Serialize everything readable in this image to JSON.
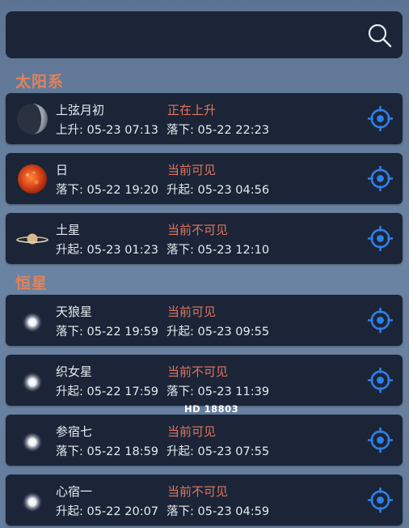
{
  "sections": {
    "solar": "太阳系",
    "stars": "恒星"
  },
  "items": [
    {
      "name": "上弦月初",
      "status": "正在上升",
      "t1_label": "上升:",
      "t1": "05-23 07:13",
      "t2_label": "落下:",
      "t2": "05-22 22:23"
    },
    {
      "name": "日",
      "status": "当前可见",
      "t1_label": "落下:",
      "t1": "05-22 19:20",
      "t2_label": "升起:",
      "t2": "05-23 04:56"
    },
    {
      "name": "土星",
      "status": "当前不可见",
      "t1_label": "升起:",
      "t1": "05-23 01:23",
      "t2_label": "落下:",
      "t2": "05-23 12:10"
    },
    {
      "name": "天狼星",
      "status": "当前可见",
      "t1_label": "落下:",
      "t1": "05-22 19:59",
      "t2_label": "升起:",
      "t2": "05-23 09:55"
    },
    {
      "name": "织女星",
      "status": "当前不可见",
      "t1_label": "升起:",
      "t1": "05-22 17:59",
      "t2_label": "落下:",
      "t2": "05-23 11:39"
    },
    {
      "name": "参宿七",
      "status": "当前可见",
      "t1_label": "落下:",
      "t1": "05-22 18:59",
      "t2_label": "升起:",
      "t2": "05-23 07:55"
    },
    {
      "name": "心宿一",
      "status": "当前不可见",
      "t1_label": "升起:",
      "t1": "05-22 20:07",
      "t2_label": "落下:",
      "t2": "05-23 04:59"
    }
  ],
  "overlay_label": "HD 18803",
  "icons": {
    "search": "search-icon",
    "target": "crosshair-target-icon",
    "moon": "moon-icon",
    "sun": "sun-icon",
    "saturn": "saturn-icon",
    "star": "star-icon"
  },
  "colors": {
    "accent": "#e2825a",
    "status": "#e07560",
    "target": "#2f7fe8",
    "card": "#1b2537"
  }
}
